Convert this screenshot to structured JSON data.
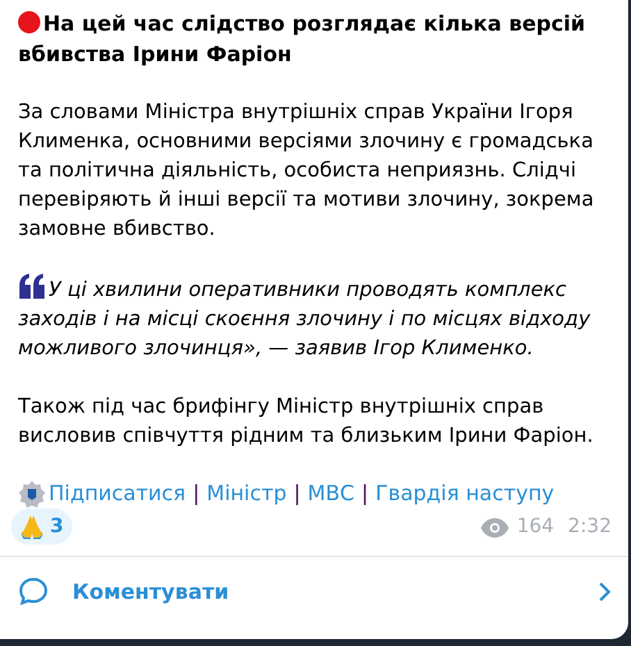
{
  "post": {
    "title": "На цей час слідство розглядає кілька версій вбивства Ірини Фаріон",
    "paragraphs": [
      {
        "kind": "text",
        "text": "За словами Міністра внутрішніх справ України Ігоря Клименка, основними версіями злочину є громадська та політична діяльність, особиста неприязнь. Слідчі перевіряють й інші версії та мотиви злочину, зокрема замовне вбивство."
      },
      {
        "kind": "quote",
        "text": "У ці хвилини оперативники проводять комплекс заходів і на місці скоєння злочину і по місцях відходу можливого злочинця», — заявив Ігор Клименко."
      },
      {
        "kind": "text",
        "text": "Також під час брифінгу Міністр внутрішніх справ висловив співчуття рідним та близьким Ірини Фаріон."
      }
    ],
    "footer_links": [
      {
        "kind": "link",
        "text": "Підписатися"
      },
      {
        "kind": "separator",
        "text": "|"
      },
      {
        "kind": "link",
        "text": "Міністр"
      },
      {
        "kind": "separator",
        "text": "|"
      },
      {
        "kind": "link",
        "text": "МВС"
      },
      {
        "kind": "separator",
        "text": "|"
      },
      {
        "kind": "link",
        "text": "Гвардія наступу"
      }
    ],
    "reactions": [
      {
        "count": "3"
      }
    ],
    "views": "164",
    "time": "2:32"
  },
  "comments": {
    "label": "Коментувати"
  }
}
